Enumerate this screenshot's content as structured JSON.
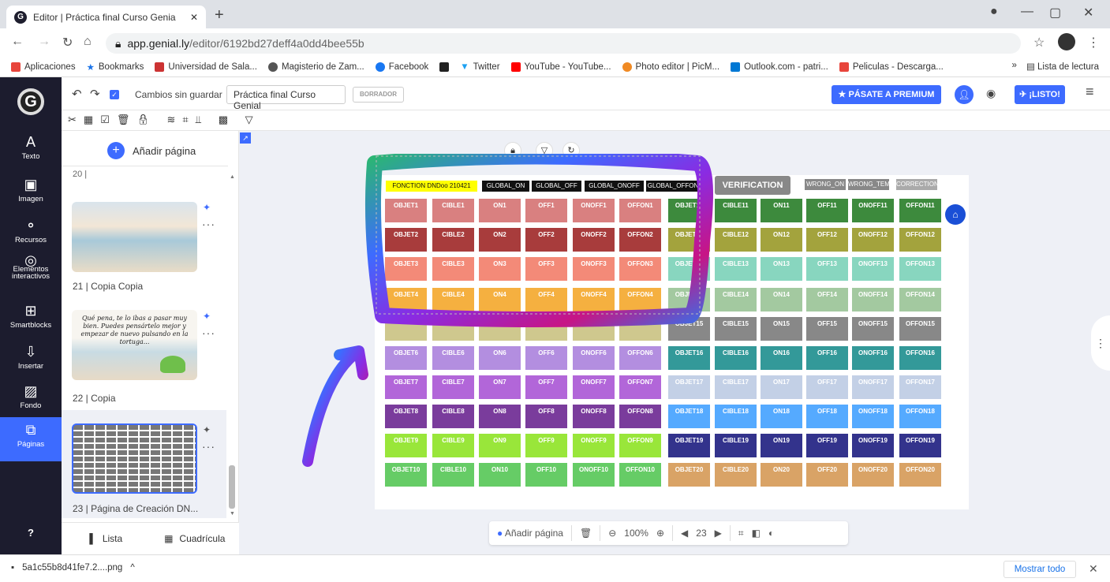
{
  "browser": {
    "tab_title": "Editor | Práctica final Curso Genia",
    "favicon": "G",
    "url_host": "app.genial.ly",
    "url_path": "/editor/6192bd27deff4a0dd4bee55b",
    "bookmarks": [
      "Aplicaciones",
      "Bookmarks",
      "Universidad de Sala...",
      "Magisterio de Zam...",
      "Facebook",
      "Twitter",
      "YouTube - YouTube...",
      "Photo editor | PicM...",
      "Outlook.com - patri...",
      "Peliculas - Descarga..."
    ],
    "bookmark_colors": [
      "#e8453c",
      "#1a73e8",
      "#e8453c",
      "#555555",
      "#1877f2",
      "#1da1f2",
      "#ff0000",
      "#f08a24",
      "#0078d4",
      "#e8453c"
    ],
    "reading_list": "Lista de lectura"
  },
  "toolbar": {
    "unsaved": "Cambios sin guardar",
    "title": "Práctica final Curso Genial",
    "draft": "BORRADOR",
    "premium": "PÁSATE A PREMIUM",
    "done": "¡LISTO!"
  },
  "sidebar": {
    "items": [
      {
        "label": "Texto",
        "icon": "A"
      },
      {
        "label": "Imagen",
        "icon": "▣"
      },
      {
        "label": "Recursos",
        "icon": "⚬"
      },
      {
        "label": "Elementos interactivos",
        "icon": "◎"
      },
      {
        "label": "Smartblocks",
        "icon": "⊞"
      },
      {
        "label": "Insertar",
        "icon": "⇩"
      },
      {
        "label": "Fondo",
        "icon": "▨"
      },
      {
        "label": "Páginas",
        "icon": "⧉"
      }
    ],
    "help": "?"
  },
  "pages": {
    "add_page": "Añadir página",
    "prev_label": "20 |",
    "items": [
      "21 | Copia Copia",
      "22 | Copia",
      "23 | Página de Creación DN..."
    ],
    "thumb_text": "Qué pena, te lo ibas a pasar muy bien. Puedes pensártelo mejor y empezar de nuevo pulsando en la tortuga...",
    "tabs": [
      "Lista",
      "Cuadrícula"
    ]
  },
  "slide": {
    "headers": [
      "FONCTION DNDoo 210421",
      "GLOBAL_ON",
      "GLOBAL_OFF",
      "GLOBAL_ONOFF",
      "GLOBAL_OFFON"
    ],
    "verification": "VERIFICATION",
    "right_headers": [
      "WRONG_ON",
      "WRONG_TEMP",
      "CORRECTION"
    ],
    "left_rows": [
      {
        "color": "#d98080",
        "cells": [
          "OBJET1",
          "CIBLE1",
          "ON1",
          "OFF1",
          "ONOFF1",
          "OFFON1"
        ]
      },
      {
        "color": "#a83c3c",
        "cells": [
          "OBJET2",
          "CIBLE2",
          "ON2",
          "OFF2",
          "ONOFF2",
          "OFFON2"
        ]
      },
      {
        "color": "#f38a78",
        "cells": [
          "OBJET3",
          "CIBLE3",
          "ON3",
          "OFF3",
          "ONOFF3",
          "OFFON3"
        ]
      },
      {
        "color": "#f5b040",
        "cells": [
          "OBJET4",
          "CIBLE4",
          "ON4",
          "OFF4",
          "ONOFF4",
          "OFFON4"
        ]
      },
      {
        "color": "#cfc88e",
        "cells": [
          "",
          "",
          "",
          "",
          "",
          ""
        ]
      },
      {
        "color": "#b38ee0",
        "cells": [
          "OBJET6",
          "CIBLE6",
          "ON6",
          "OFF6",
          "ONOFF6",
          "OFFON6"
        ]
      },
      {
        "color": "#b266d9",
        "cells": [
          "OBJET7",
          "CIBLE7",
          "ON7",
          "OFF7",
          "ONOFF7",
          "OFFON7"
        ]
      },
      {
        "color": "#7a3c9c",
        "cells": [
          "OBJET8",
          "CIBLE8",
          "ON8",
          "OFF8",
          "ONOFF8",
          "OFFON8"
        ]
      },
      {
        "color": "#99e63a",
        "cells": [
          "OBJET9",
          "CIBLE9",
          "ON9",
          "OFF9",
          "ONOFF9",
          "OFFON9"
        ]
      },
      {
        "color": "#66cc66",
        "cells": [
          "OBJET10",
          "CIBLE10",
          "ON10",
          "OFF10",
          "ONOFF10",
          "OFFON10"
        ]
      }
    ],
    "right_rows": [
      {
        "color": "#3d8a3d",
        "cells": [
          "OBJET11",
          "CIBLE11",
          "ON11",
          "OFF11",
          "ONOFF11",
          "OFFON11"
        ]
      },
      {
        "color": "#a3a33d",
        "cells": [
          "OBJET12",
          "CIBLE12",
          "ON12",
          "OFF12",
          "ONOFF12",
          "OFFON12"
        ]
      },
      {
        "color": "#88d6bf",
        "cells": [
          "OBJET13",
          "CIBLE13",
          "ON13",
          "OFF13",
          "ONOFF13",
          "OFFON13"
        ]
      },
      {
        "color": "#a3c9a0",
        "cells": [
          "OBJET14",
          "CIBLE14",
          "ON14",
          "OFF14",
          "ONOFF14",
          "OFFON14"
        ]
      },
      {
        "color": "#888888",
        "cells": [
          "OBJET15",
          "CIBLE15",
          "ON15",
          "OFF15",
          "ONOFF15",
          "OFFON15"
        ]
      },
      {
        "color": "#339999",
        "cells": [
          "OBJET16",
          "CIBLE16",
          "ON16",
          "OFF16",
          "ONOFF16",
          "OFFON16"
        ]
      },
      {
        "color": "#c3d0e6",
        "cells": [
          "OBJET17",
          "CIBLE17",
          "ON17",
          "OFF17",
          "ONOFF17",
          "OFFON17"
        ]
      },
      {
        "color": "#55aaff",
        "cells": [
          "OBJET18",
          "CIBLE18",
          "ON18",
          "OFF18",
          "ONOFF18",
          "OFFON18"
        ]
      },
      {
        "color": "#33338c",
        "cells": [
          "OBJET19",
          "CIBLE19",
          "ON19",
          "OFF19",
          "ONOFF19",
          "OFFON19"
        ]
      },
      {
        "color": "#d9a366",
        "cells": [
          "OBJET20",
          "CIBLE20",
          "ON20",
          "OFF20",
          "ONOFF20",
          "OFFON20"
        ]
      }
    ]
  },
  "canvas_toolbar": {
    "add_page": "Añadir página",
    "zoom": "100%",
    "page": "23"
  },
  "download": {
    "file": "5a1c55b8d41fe7.2....png",
    "show_all": "Mostrar todo"
  }
}
